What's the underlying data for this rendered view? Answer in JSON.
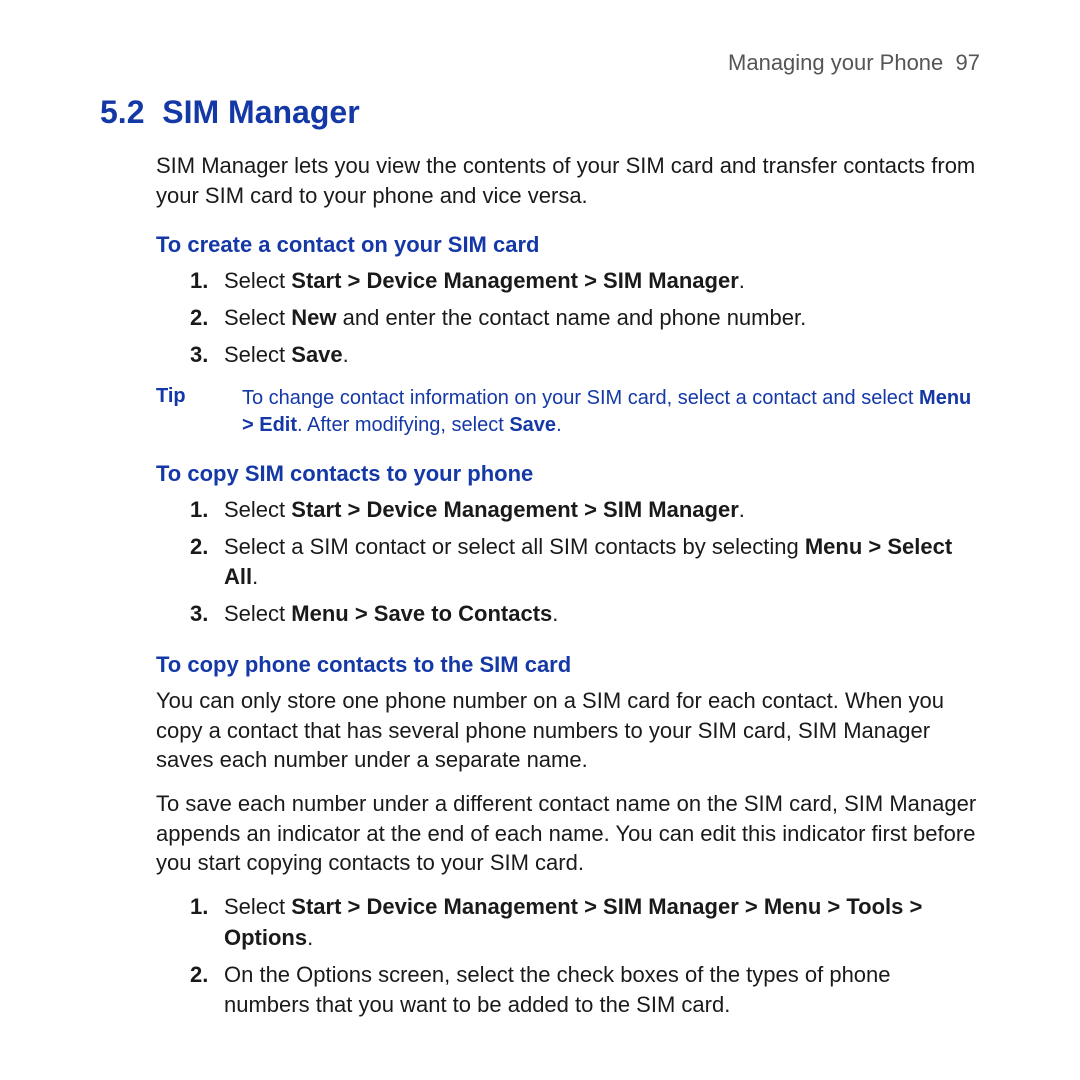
{
  "header": {
    "chapter": "Managing your Phone",
    "page_number": "97"
  },
  "section": {
    "number": "5.2",
    "title": "SIM Manager"
  },
  "intro": "SIM Manager lets you view the contents of your SIM card and transfer contacts from your SIM card to your phone and vice versa.",
  "sec1": {
    "heading": "To create a contact on your SIM card",
    "steps": {
      "n1": "1.",
      "s1a": "Select ",
      "s1b": "Start > Device Management > SIM Manager",
      "s1c": ".",
      "n2": "2.",
      "s2a": "Select ",
      "s2b": "New",
      "s2c": " and enter the contact name and phone number.",
      "n3": "3.",
      "s3a": "Select ",
      "s3b": "Save",
      "s3c": "."
    }
  },
  "tip": {
    "label": "Tip",
    "t1": "To change contact information on your SIM card, select a contact and select ",
    "t2": "Menu > Edit",
    "t3": ". After modifying, select ",
    "t4": "Save",
    "t5": "."
  },
  "sec2": {
    "heading": "To copy SIM contacts to your phone",
    "steps": {
      "n1": "1.",
      "s1a": "Select ",
      "s1b": "Start > Device Management > SIM Manager",
      "s1c": ".",
      "n2": "2.",
      "s2a": "Select a SIM contact or select all SIM contacts by selecting ",
      "s2b": "Menu > Select All",
      "s2c": ".",
      "n3": "3.",
      "s3a": "Select ",
      "s3b": "Menu > Save to Contacts",
      "s3c": "."
    }
  },
  "sec3": {
    "heading": "To copy phone contacts to the SIM card",
    "p1": "You can only store one phone number on a SIM card for each contact. When you copy a contact that has several phone numbers to your SIM card, SIM Manager saves each number under a separate name.",
    "p2": "To save each number under a different contact name on the SIM card, SIM Manager appends an indicator at the end of each name. You can edit this indicator first before you start copying contacts to your SIM card.",
    "steps": {
      "n1": "1.",
      "s1a": "Select ",
      "s1b": "Start > Device Management > SIM Manager > Menu > Tools > Options",
      "s1c": ".",
      "n2": "2.",
      "s2a": "On the Options screen, select the check boxes of the types of phone numbers that you want to be added to the SIM card."
    }
  }
}
